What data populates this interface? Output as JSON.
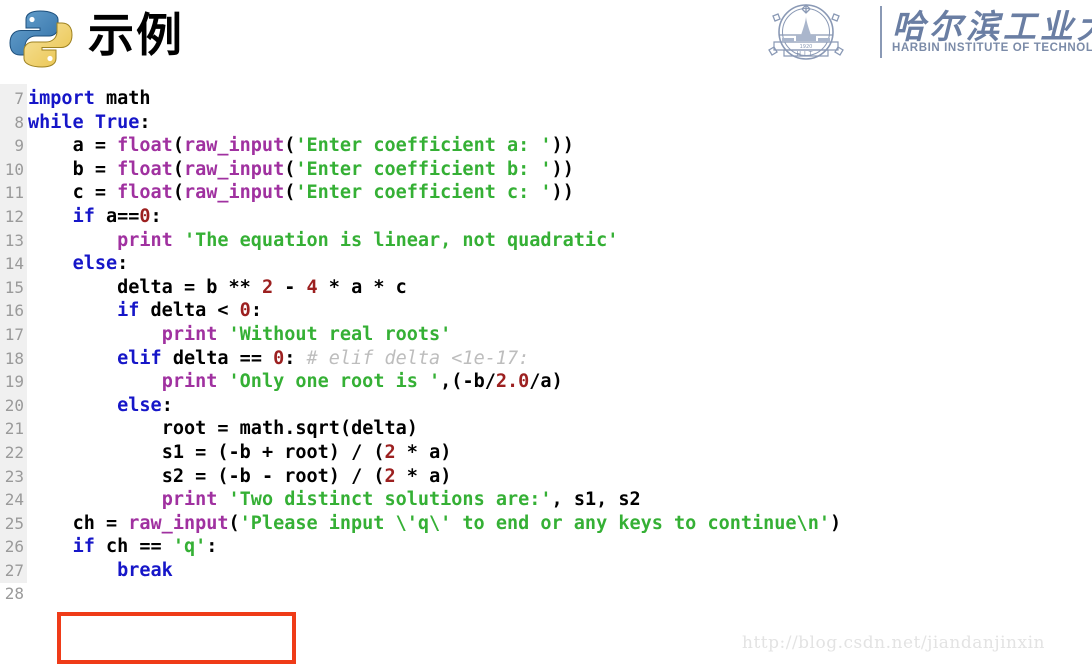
{
  "header": {
    "title": "示例",
    "python_logo_alt": "python-logo",
    "university": {
      "name_cn": "哈尔滨工业大学",
      "name_en": "HARBIN INSTITUTE OF TECHNOLOGY",
      "crest_year": "1920",
      "crest_initials": "H I T"
    }
  },
  "colors": {
    "keyword": "#1616c8",
    "builtin": "#a031a0",
    "string": "#35b035",
    "number": "#9c2020",
    "comment": "#bdbdbd",
    "plain": "#000000",
    "gutter_bg": "#f0f0f0",
    "line_number": "#9a9a9a",
    "highlight_border": "#ef3b18",
    "watermark": "#e3e3e3",
    "hit_blue": "#6a7ea3"
  },
  "code": {
    "language": "python",
    "first_line_number": 7,
    "lines": [
      {
        "n": "7",
        "text": "import math"
      },
      {
        "n": "8",
        "text": "while True:"
      },
      {
        "n": "9",
        "text": "    a = float(raw_input('Enter coefficient a: '))"
      },
      {
        "n": "10",
        "text": "    b = float(raw_input('Enter coefficient b: '))"
      },
      {
        "n": "11",
        "text": "    c = float(raw_input('Enter coefficient c: '))"
      },
      {
        "n": "12",
        "text": "    if a==0:"
      },
      {
        "n": "13",
        "text": "        print 'The equation is linear, not quadratic'"
      },
      {
        "n": "14",
        "text": "    else:"
      },
      {
        "n": "15",
        "text": "        delta = b ** 2 - 4 * a * c"
      },
      {
        "n": "16",
        "text": "        if delta < 0:"
      },
      {
        "n": "17",
        "text": "            print 'Without real roots'"
      },
      {
        "n": "18",
        "text": "        elif delta == 0: # elif delta <1e-17:"
      },
      {
        "n": "19",
        "text": "            print 'Only one root is ',(-b/2.0/a)"
      },
      {
        "n": "20",
        "text": "        else:"
      },
      {
        "n": "21",
        "text": "            root = math.sqrt(delta)"
      },
      {
        "n": "22",
        "text": "            s1 = (-b + root) / (2 * a)"
      },
      {
        "n": "23",
        "text": "            s2 = (-b - root) / (2 * a)"
      },
      {
        "n": "24",
        "text": "            print 'Two distinct solutions are:', s1, s2"
      },
      {
        "n": "25",
        "text": "    ch = raw_input('Please input \\'q\\' to end or any keys to continue\\n')"
      },
      {
        "n": "26",
        "text": "    if ch == 'q':"
      },
      {
        "n": "27",
        "text": "        break"
      },
      {
        "n": "28",
        "text": ""
      }
    ]
  },
  "annotation": {
    "highlight_label": "red-box-around-if-ch-break"
  },
  "watermark": {
    "text": "http://blog.csdn.net/jiandanjinxin"
  }
}
